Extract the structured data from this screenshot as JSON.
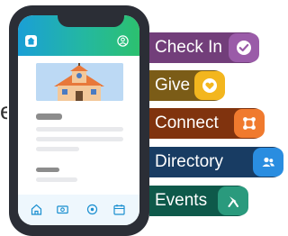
{
  "stray_text": "e",
  "features": [
    {
      "label": "Check In",
      "icon": "checkmark-icon",
      "bg": "#723e7a",
      "badge": "#9a5ba8"
    },
    {
      "label": "Give",
      "icon": "heart-icon",
      "bg": "#7b5c17",
      "badge": "#f3b61e"
    },
    {
      "label": "Connect",
      "icon": "connect-icon",
      "bg": "#80330e",
      "badge": "#f07a2e"
    },
    {
      "label": "Directory",
      "icon": "people-icon",
      "bg": "#183c63",
      "badge": "#2a8de0"
    },
    {
      "label": "Events",
      "icon": "sign-icon",
      "bg": "#0e594a",
      "badge": "#2a9a7d"
    }
  ],
  "phone": {
    "header_icons": [
      "home-icon",
      "profile-icon"
    ],
    "hero_image": "church-illustration",
    "nav_icons": [
      "home-icon",
      "ticket-icon",
      "connect-icon",
      "calendar-icon"
    ],
    "colors": {
      "header_start": "#1a9fd6",
      "header_end": "#2cc16f",
      "frame": "#2b2e36",
      "nav_bar": "#eef7fd"
    }
  }
}
